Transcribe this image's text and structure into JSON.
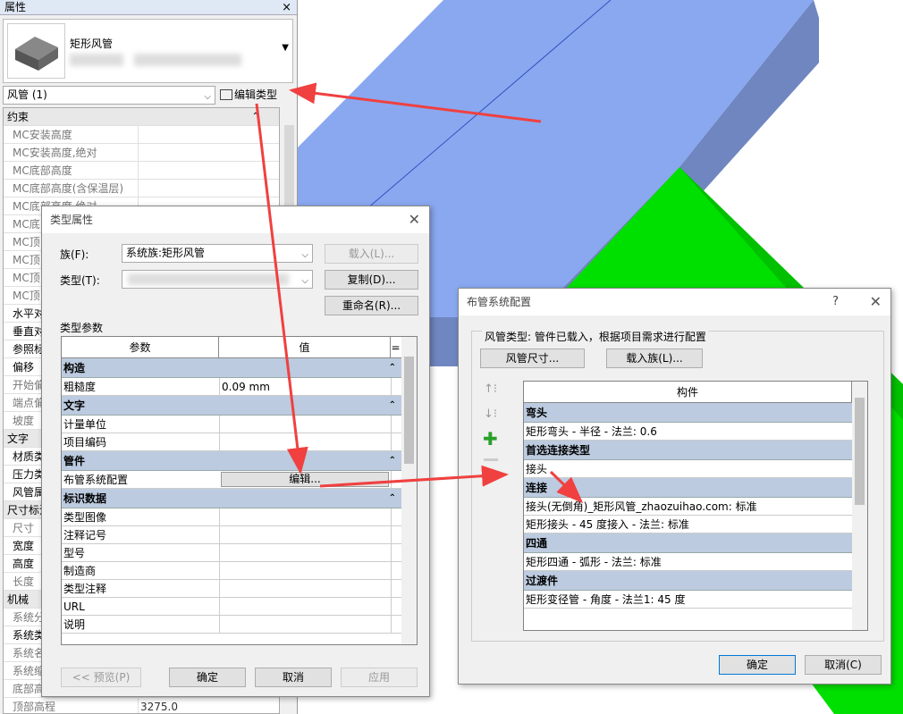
{
  "properties": {
    "title": "属性",
    "close": "×",
    "type_name": "矩形风管",
    "instance_filter": "风管 (1)",
    "edit_type_label": "编辑类型",
    "rows": [
      {
        "k": "约束",
        "v": "",
        "group": true
      },
      {
        "k": "MC安装高度",
        "v": ""
      },
      {
        "k": "MC安装高度,绝对",
        "v": ""
      },
      {
        "k": "MC底部高度",
        "v": ""
      },
      {
        "k": "MC底部高度(含保温层)",
        "v": ""
      },
      {
        "k": "MC底部高度,绝对",
        "v": ""
      },
      {
        "k": "MC底",
        "v": ""
      },
      {
        "k": "MC顶",
        "v": ""
      },
      {
        "k": "MC顶",
        "v": ""
      },
      {
        "k": "MC顶",
        "v": ""
      },
      {
        "k": "MC顶",
        "v": ""
      },
      {
        "k": "水平对",
        "v": "",
        "bold": true
      },
      {
        "k": "垂直对",
        "v": "",
        "bold": true
      },
      {
        "k": "参照标",
        "v": "",
        "bold": true
      },
      {
        "k": "偏移",
        "v": "",
        "bold": true
      },
      {
        "k": "开始偏",
        "v": ""
      },
      {
        "k": "端点偏",
        "v": ""
      },
      {
        "k": "坡度",
        "v": ""
      },
      {
        "k": "文字",
        "v": "",
        "group": true
      },
      {
        "k": "材质类",
        "v": "",
        "bold": true
      },
      {
        "k": "压力类",
        "v": "",
        "bold": true
      },
      {
        "k": "风管属",
        "v": "",
        "bold": true
      },
      {
        "k": "尺寸标注",
        "v": "",
        "group": true
      },
      {
        "k": "尺寸",
        "v": ""
      },
      {
        "k": "宽度",
        "v": "",
        "bold": true
      },
      {
        "k": "高度",
        "v": "",
        "bold": true
      },
      {
        "k": "长度",
        "v": ""
      },
      {
        "k": "机械",
        "v": "",
        "group": true
      },
      {
        "k": "系统分",
        "v": ""
      },
      {
        "k": "系统类",
        "v": "",
        "bold": true
      },
      {
        "k": "系统名",
        "v": ""
      },
      {
        "k": "系统缩",
        "v": ""
      },
      {
        "k": "底部高",
        "v": ""
      },
      {
        "k": "顶部高程",
        "v": "3275.0"
      }
    ]
  },
  "type_dialog": {
    "title": "类型属性",
    "family_label": "族(F):",
    "family_value": "系统族:矩形风管",
    "type_label": "类型(T):",
    "load_btn": "载入(L)...",
    "copy_btn": "复制(D)...",
    "rename_btn": "重命名(R)...",
    "params_label": "类型参数",
    "col_param": "参数",
    "col_value": "值",
    "col_eq": "=",
    "groups": [
      {
        "name": "构造",
        "rows": [
          {
            "k": "粗糙度",
            "v": "0.09 mm"
          }
        ]
      },
      {
        "name": "文字",
        "rows": [
          {
            "k": "计量单位",
            "v": ""
          },
          {
            "k": "项目编码",
            "v": ""
          }
        ]
      },
      {
        "name": "管件",
        "rows": [
          {
            "k": "布管系统配置",
            "v": "编辑...",
            "button": true
          }
        ]
      },
      {
        "name": "标识数据",
        "rows": [
          {
            "k": "类型图像",
            "v": ""
          },
          {
            "k": "注释记号",
            "v": ""
          },
          {
            "k": "型号",
            "v": ""
          },
          {
            "k": "制造商",
            "v": ""
          },
          {
            "k": "类型注释",
            "v": ""
          },
          {
            "k": "URL",
            "v": ""
          },
          {
            "k": "说明",
            "v": ""
          }
        ]
      }
    ],
    "preview_btn": "<< 预览(P)",
    "ok_btn": "确定",
    "cancel_btn": "取消",
    "apply_btn": "应用"
  },
  "routing_dialog": {
    "title": "布管系统配置",
    "help": "?",
    "close": "×",
    "duct_type_label": "风管类型: 管件已载入，根据项目需求进行配置",
    "duct_size_btn": "风管尺寸...",
    "load_family_btn": "载入族(L)...",
    "col_component": "构件",
    "groups": [
      {
        "name": "弯头",
        "rows": [
          "矩形弯头 - 半径 - 法兰: 0.6"
        ]
      },
      {
        "name": "首选连接类型",
        "rows": [
          "接头"
        ]
      },
      {
        "name": "连接",
        "rows": [
          "接头(无倒角)_矩形风管_zhaozuihao.com: 标准",
          "矩形接头 - 45 度接入 - 法兰: 标准"
        ]
      },
      {
        "name": "四通",
        "rows": [
          "矩形四通 - 弧形 - 法兰: 标准"
        ]
      },
      {
        "name": "过渡件",
        "rows": [
          "矩形变径管 - 角度 - 法兰1: 45 度"
        ]
      }
    ],
    "ok_btn": "确定",
    "cancel_btn": "取消(C)"
  },
  "colors": {
    "blue_duct": "#8aa8f0",
    "blue_dark": "#6f86c0",
    "green": "#00e000",
    "arrow": "#f04040",
    "group_header": "#bccbdf"
  }
}
